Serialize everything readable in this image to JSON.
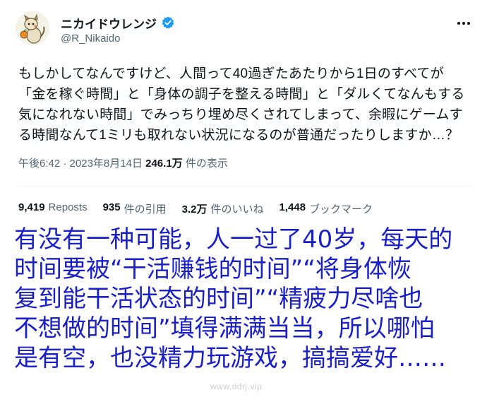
{
  "user": {
    "display_name": "ニカイドウレンジ",
    "handle": "@R_Nikaido",
    "verified": true,
    "avatar_icon": "cartoon-creature-avatar"
  },
  "tweet": {
    "lines": [
      "もしかしてなんですけど、人間って40過ぎたあたりから1日のすべてが",
      "「金を稼ぐ時間」と「身体の調子を整える時間」と「ダルくてなんもする",
      "気になれない時間」でみっちり埋め尽くされてしまって、余暇にゲームす",
      "る時間なんて1ミリも取れない状況になるのが普通だったりしますか…？"
    ],
    "time": "午後6:42",
    "date": "2023年8月14日",
    "views_count": "246.1万",
    "views_label": "件の表示"
  },
  "stats": {
    "reposts_count": "9,419",
    "reposts_label": "Reposts",
    "quotes_count": "935",
    "quotes_label": "件の引用",
    "likes_count": "3.2万",
    "likes_label": "件のいいね",
    "bookmarks_count": "1,448",
    "bookmarks_label": "ブックマーク"
  },
  "translation": {
    "lines": [
      "有没有一种可能，人一过了40岁，每天的",
      "时间要被“干活赚钱的时间”“将身体恢",
      "复到能干活状态的时间”“精疲力尽啥也",
      "不想做的时间”填得满满当当，所以哪怕",
      "是有空，也没精力玩游戏，搞搞爱好……"
    ]
  },
  "watermark": "www.ddrj.vip",
  "colors": {
    "text_primary": "#0f1419",
    "text_secondary": "#536471",
    "verified": "#1d9bf0",
    "translation": "#1a20c8"
  }
}
